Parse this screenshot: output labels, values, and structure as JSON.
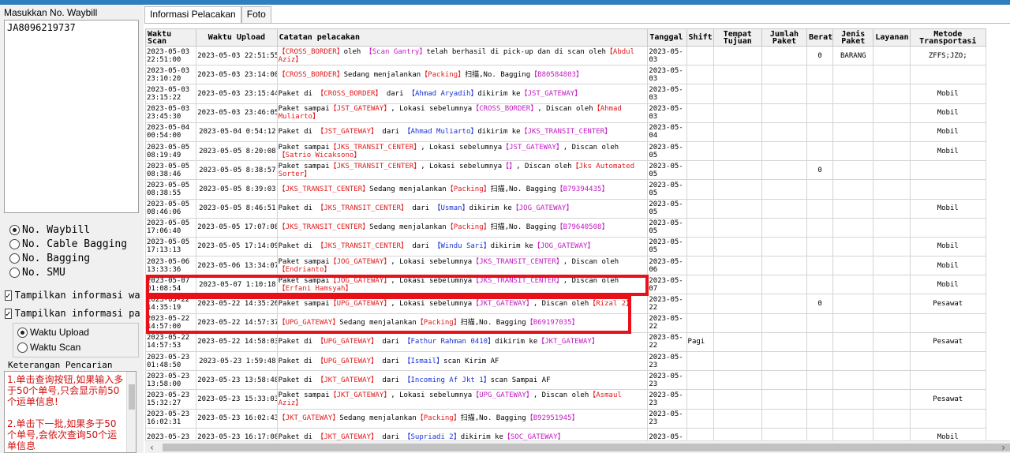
{
  "left_panel": {
    "waybill_label": "Masukkan No. Waybill",
    "waybill_value": "JA8096219737",
    "radios": [
      {
        "label": "No. Waybill",
        "selected": true
      },
      {
        "label": "No. Cable Bagging",
        "selected": false
      },
      {
        "label": "No. Bagging",
        "selected": false
      },
      {
        "label": "No. SMU",
        "selected": false
      }
    ],
    "checkboxes": [
      {
        "label": "Tampilkan informasi way",
        "checked": true
      },
      {
        "label": "Tampilkan informasi pak",
        "checked": true
      }
    ],
    "time_radios": [
      {
        "label": "Waktu Upload",
        "selected": true
      },
      {
        "label": "Waktu Scan",
        "selected": false
      }
    ],
    "keterangan_label": "Keterangan Pencarian",
    "keterangan_p1": "1.单击查询按钮,如果输入多于50个单号,只会显示前50个运单信息!",
    "keterangan_p2": "2.单击下一批,如果多于50个单号,会依次查询50个运单信息"
  },
  "tabs": [
    {
      "label": "Informasi Pelacakan",
      "active": true
    },
    {
      "label": "Foto",
      "active": false
    }
  ],
  "columns": [
    "Waktu Scan",
    "Waktu Upload",
    "Catatan pelacakan",
    "Tanggal",
    "Shift",
    "Tempat Tujuan",
    "Jumlah Paket",
    "Berat",
    "Jenis Paket",
    "Layanan",
    "Metode Transportasi"
  ],
  "rows": [
    {
      "scan": "2023-05-03 22:51:00",
      "upload": "2023-05-03 22:51:55",
      "note": [
        [
          "r",
          "【CROSS_BORDER】"
        ],
        [
          "k",
          "oleh "
        ],
        [
          "m",
          "【Scan Gantry】"
        ],
        [
          "k",
          "telah berhasil di pick-up dan di scan oleh"
        ],
        [
          "r",
          "【Abdul Aziz】"
        ]
      ],
      "tanggal": "2023-05-03",
      "shift": "",
      "berat": "0",
      "jenis": "BARANG",
      "metode": "ZFFS;JZO;"
    },
    {
      "scan": "2023-05-03 23:10:20",
      "upload": "2023-05-03 23:14:00",
      "note": [
        [
          "r",
          "【CROSS_BORDER】"
        ],
        [
          "k",
          "Sedang menjalankan"
        ],
        [
          "r",
          "【Packing】"
        ],
        [
          "k",
          "扫描,No. Bagging"
        ],
        [
          "m",
          "【B80584803】"
        ]
      ],
      "tanggal": "2023-05-03",
      "shift": "",
      "berat": "",
      "jenis": "",
      "metode": ""
    },
    {
      "scan": "2023-05-03 23:15:22",
      "upload": "2023-05-03 23:15:44",
      "note": [
        [
          "k",
          "Paket di "
        ],
        [
          "r",
          "【CROSS_BORDER】"
        ],
        [
          "k",
          " dari "
        ],
        [
          "b",
          "【Ahmad Aryadih】"
        ],
        [
          "k",
          "dikirim ke"
        ],
        [
          "m",
          "【JST_GATEWAY】"
        ]
      ],
      "tanggal": "2023-05-03",
      "shift": "",
      "berat": "",
      "jenis": "",
      "metode": "Mobil"
    },
    {
      "scan": "2023-05-03 23:45:30",
      "upload": "2023-05-03 23:46:05",
      "note": [
        [
          "k",
          "Paket sampai"
        ],
        [
          "r",
          "【JST_GATEWAY】"
        ],
        [
          "k",
          ", Lokasi sebelumnya"
        ],
        [
          "m",
          "【CROSS_BORDER】"
        ],
        [
          "k",
          ", Discan oleh"
        ],
        [
          "r",
          "【Ahmad Muliarto】"
        ]
      ],
      "tanggal": "2023-05-03",
      "shift": "",
      "berat": "",
      "jenis": "",
      "metode": "Mobil"
    },
    {
      "scan": "2023-05-04 00:54:00",
      "upload": "2023-05-04 0:54:12",
      "note": [
        [
          "k",
          "Paket di "
        ],
        [
          "r",
          "【JST_GATEWAY】"
        ],
        [
          "k",
          " dari "
        ],
        [
          "b",
          "【Ahmad Muliarto】"
        ],
        [
          "k",
          "dikirim ke"
        ],
        [
          "m",
          "【JKS_TRANSIT_CENTER】"
        ]
      ],
      "tanggal": "2023-05-04",
      "shift": "",
      "berat": "",
      "jenis": "",
      "metode": "Mobil"
    },
    {
      "scan": "2023-05-05 08:19:49",
      "upload": "2023-05-05 8:20:08",
      "note": [
        [
          "k",
          "Paket sampai"
        ],
        [
          "r",
          "【JKS_TRANSIT_CENTER】"
        ],
        [
          "k",
          ", Lokasi sebelumnya"
        ],
        [
          "m",
          "【JST_GATEWAY】"
        ],
        [
          "k",
          ", Discan oleh"
        ],
        [
          "r",
          "【Satrio Wicaksono】"
        ]
      ],
      "tanggal": "2023-05-05",
      "shift": "",
      "berat": "",
      "jenis": "",
      "metode": "Mobil"
    },
    {
      "scan": "2023-05-05 08:38:46",
      "upload": "2023-05-05 8:38:57",
      "note": [
        [
          "k",
          "Paket sampai"
        ],
        [
          "r",
          "【JKS_TRANSIT_CENTER】"
        ],
        [
          "k",
          ", Lokasi sebelumnya"
        ],
        [
          "m",
          "【】"
        ],
        [
          "k",
          ", Discan oleh"
        ],
        [
          "r",
          "【Jks Automated Sorter】"
        ]
      ],
      "tanggal": "2023-05-05",
      "shift": "",
      "berat": "0",
      "jenis": "",
      "metode": ""
    },
    {
      "scan": "2023-05-05 08:38:55",
      "upload": "2023-05-05 8:39:03",
      "note": [
        [
          "r",
          "【JKS_TRANSIT_CENTER】"
        ],
        [
          "k",
          "Sedang menjalankan"
        ],
        [
          "r",
          "【Packing】"
        ],
        [
          "k",
          "扫描,No. Bagging"
        ],
        [
          "m",
          "【B79394435】"
        ]
      ],
      "tanggal": "2023-05-05",
      "shift": "",
      "berat": "",
      "jenis": "",
      "metode": ""
    },
    {
      "scan": "2023-05-05 08:46:06",
      "upload": "2023-05-05 8:46:51",
      "note": [
        [
          "k",
          "Paket di "
        ],
        [
          "r",
          "【JKS_TRANSIT_CENTER】"
        ],
        [
          "k",
          " dari "
        ],
        [
          "b",
          "【Usman】"
        ],
        [
          "k",
          "dikirim ke"
        ],
        [
          "m",
          "【JOG_GATEWAY】"
        ]
      ],
      "tanggal": "2023-05-05",
      "shift": "",
      "berat": "",
      "jenis": "",
      "metode": "Mobil"
    },
    {
      "scan": "2023-05-05 17:06:40",
      "upload": "2023-05-05 17:07:08",
      "note": [
        [
          "r",
          "【JKS_TRANSIT_CENTER】"
        ],
        [
          "k",
          "Sedang menjalankan"
        ],
        [
          "r",
          "【Packing】"
        ],
        [
          "k",
          "扫描,No. Bagging"
        ],
        [
          "m",
          "【B79640508】"
        ]
      ],
      "tanggal": "2023-05-05",
      "shift": "",
      "berat": "",
      "jenis": "",
      "metode": ""
    },
    {
      "scan": "2023-05-05 17:13:13",
      "upload": "2023-05-05 17:14:09",
      "note": [
        [
          "k",
          "Paket di "
        ],
        [
          "r",
          "【JKS_TRANSIT_CENTER】"
        ],
        [
          "k",
          " dari "
        ],
        [
          "b",
          "【Windu Sari】"
        ],
        [
          "k",
          "dikirim ke"
        ],
        [
          "m",
          "【JOG_GATEWAY】"
        ]
      ],
      "tanggal": "2023-05-05",
      "shift": "",
      "berat": "",
      "jenis": "",
      "metode": "Mobil"
    },
    {
      "scan": "2023-05-06 13:33:36",
      "upload": "2023-05-06 13:34:07",
      "note": [
        [
          "k",
          "Paket sampai"
        ],
        [
          "r",
          "【JOG_GATEWAY】"
        ],
        [
          "k",
          ", Lokasi sebelumnya"
        ],
        [
          "m",
          "【JKS_TRANSIT_CENTER】"
        ],
        [
          "k",
          ", Discan oleh"
        ],
        [
          "r",
          "【Endrianto】"
        ]
      ],
      "tanggal": "2023-05-06",
      "shift": "",
      "berat": "",
      "jenis": "",
      "metode": "Mobil"
    },
    {
      "scan": "2023-05-07 01:08:54",
      "upload": "2023-05-07 1:10:18",
      "note": [
        [
          "k",
          "Paket sampai"
        ],
        [
          "r",
          "【JOG_GATEWAY】"
        ],
        [
          "k",
          ", Lokasi sebelumnya"
        ],
        [
          "m",
          "【JKS_TRANSIT_CENTER】"
        ],
        [
          "k",
          ", Discan oleh"
        ],
        [
          "r",
          "【Erfani Hamsyah】"
        ]
      ],
      "tanggal": "2023-05-07",
      "shift": "",
      "berat": "",
      "jenis": "",
      "metode": "Mobil"
    },
    {
      "scan": "2023-05-22 14:35:19",
      "upload": "2023-05-22 14:35:26",
      "note": [
        [
          "k",
          "Paket sampai"
        ],
        [
          "r",
          "【UPG_GATEWAY】"
        ],
        [
          "k",
          ", Lokasi sebelumnya"
        ],
        [
          "m",
          "【JKT_GATEWAY】"
        ],
        [
          "k",
          ", Discan oleh"
        ],
        [
          "r",
          "【Rizal 2】"
        ]
      ],
      "tanggal": "2023-05-22",
      "shift": "",
      "berat": "0",
      "jenis": "",
      "metode": "Pesawat"
    },
    {
      "scan": "2023-05-22 14:57:00",
      "upload": "2023-05-22 14:57:37",
      "note": [
        [
          "r",
          "【UPG_GATEWAY】"
        ],
        [
          "k",
          "Sedang menjalankan"
        ],
        [
          "r",
          "【Packing】"
        ],
        [
          "k",
          "扫描,No. Bagging"
        ],
        [
          "m",
          "【B69197035】"
        ]
      ],
      "tanggal": "2023-05-22",
      "shift": "",
      "berat": "",
      "jenis": "",
      "metode": ""
    },
    {
      "scan": "2023-05-22 14:57:53",
      "upload": "2023-05-22 14:58:03",
      "note": [
        [
          "k",
          "Paket di "
        ],
        [
          "r",
          "【UPG_GATEWAY】"
        ],
        [
          "k",
          " dari "
        ],
        [
          "b",
          "【Fathur Rahman 0410】"
        ],
        [
          "k",
          "dikirim ke"
        ],
        [
          "m",
          "【JKT_GATEWAY】"
        ]
      ],
      "tanggal": "2023-05-22",
      "shift": "Pagi",
      "berat": "",
      "jenis": "",
      "metode": "Pesawat"
    },
    {
      "scan": "2023-05-23 01:48:50",
      "upload": "2023-05-23 1:59:48",
      "note": [
        [
          "k",
          "Paket di "
        ],
        [
          "r",
          "【UPG_GATEWAY】"
        ],
        [
          "k",
          " dari "
        ],
        [
          "b",
          "【Ismail】"
        ],
        [
          "k",
          "scan Kirim AF"
        ]
      ],
      "tanggal": "2023-05-23",
      "shift": "",
      "berat": "",
      "jenis": "",
      "metode": ""
    },
    {
      "scan": "2023-05-23 13:58:00",
      "upload": "2023-05-23 13:58:48",
      "note": [
        [
          "k",
          "Paket di "
        ],
        [
          "r",
          "【JKT_GATEWAY】"
        ],
        [
          "k",
          " dari "
        ],
        [
          "b",
          "【Incoming Af Jkt 1】"
        ],
        [
          "k",
          "scan Sampai AF"
        ]
      ],
      "tanggal": "2023-05-23",
      "shift": "",
      "berat": "",
      "jenis": "",
      "metode": ""
    },
    {
      "scan": "2023-05-23 15:32:27",
      "upload": "2023-05-23 15:33:03",
      "note": [
        [
          "k",
          "Paket sampai"
        ],
        [
          "r",
          "【JKT_GATEWAY】"
        ],
        [
          "k",
          ", Lokasi sebelumnya"
        ],
        [
          "m",
          "【UPG_GATEWAY】"
        ],
        [
          "k",
          ", Discan oleh"
        ],
        [
          "r",
          "【Asmaul Aziz】"
        ]
      ],
      "tanggal": "2023-05-23",
      "shift": "",
      "berat": "",
      "jenis": "",
      "metode": "Pesawat"
    },
    {
      "scan": "2023-05-23 16:02:31",
      "upload": "2023-05-23 16:02:43",
      "note": [
        [
          "r",
          "【JKT_GATEWAY】"
        ],
        [
          "k",
          "Sedang menjalankan"
        ],
        [
          "r",
          "【Packing】"
        ],
        [
          "k",
          "扫描,No. Bagging"
        ],
        [
          "m",
          "【B92951945】"
        ]
      ],
      "tanggal": "2023-05-23",
      "shift": "",
      "berat": "",
      "jenis": "",
      "metode": ""
    },
    {
      "scan": "2023-05-23",
      "upload": "2023-05-23 16:17:08",
      "note": [
        [
          "k",
          "Paket di "
        ],
        [
          "r",
          "【JKT_GATEWAY】"
        ],
        [
          "k",
          " dari "
        ],
        [
          "b",
          "【Supriadi 2】"
        ],
        [
          "k",
          "dikirim ke"
        ],
        [
          "m",
          "【SOC_GATEWAY】"
        ]
      ],
      "tanggal": "2023-05-",
      "shift": "",
      "berat": "",
      "jenis": "",
      "metode": "Mobil"
    }
  ],
  "colors": {
    "red": "#e01b1b",
    "blue": "#1a33d6",
    "magenta": "#c21bc2",
    "highlight": "#e8111a",
    "topbar": "#2d7fc0"
  }
}
